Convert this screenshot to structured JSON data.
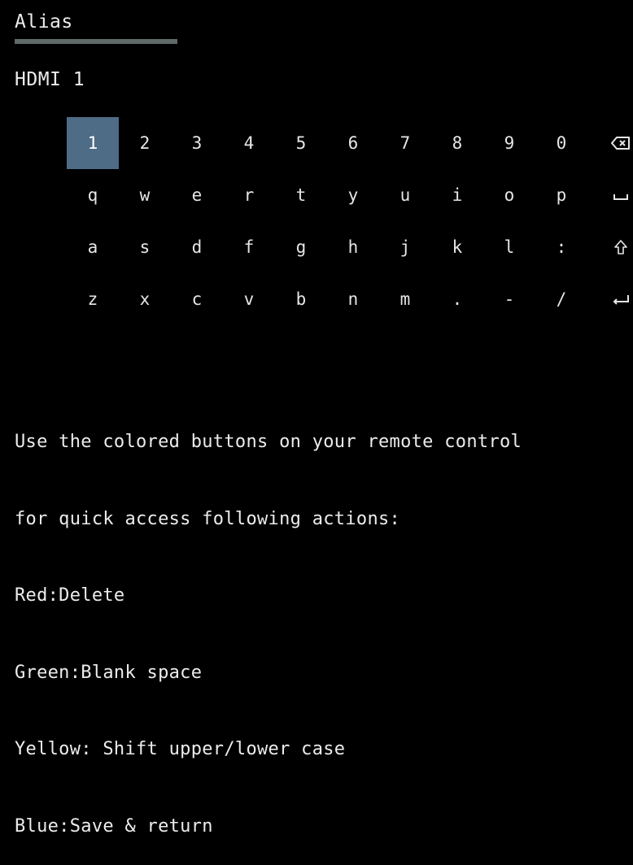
{
  "header": {
    "title": "Alias"
  },
  "input": {
    "value": "HDMI 1"
  },
  "keyboard": {
    "focused_key": "1",
    "rows": [
      [
        "1",
        "2",
        "3",
        "4",
        "5",
        "6",
        "7",
        "8",
        "9",
        "0"
      ],
      [
        "q",
        "w",
        "e",
        "r",
        "t",
        "y",
        "u",
        "i",
        "o",
        "p"
      ],
      [
        "a",
        "s",
        "d",
        "f",
        "g",
        "h",
        "j",
        "k",
        "l",
        ":"
      ],
      [
        "z",
        "x",
        "c",
        "v",
        "b",
        "n",
        "m",
        ".",
        "-",
        "/"
      ]
    ],
    "side_keys": [
      {
        "name": "backspace-icon"
      },
      {
        "name": "space-icon"
      },
      {
        "name": "shift-icon"
      },
      {
        "name": "enter-icon"
      }
    ]
  },
  "instructions": {
    "line1": "Use the colored buttons on your remote control",
    "line2": "for quick access following actions:",
    "red": "Red:Delete",
    "green": "Green:Blank space",
    "yellow": "Yellow: Shift upper/lower case",
    "blue": "Blue:Save & return"
  }
}
